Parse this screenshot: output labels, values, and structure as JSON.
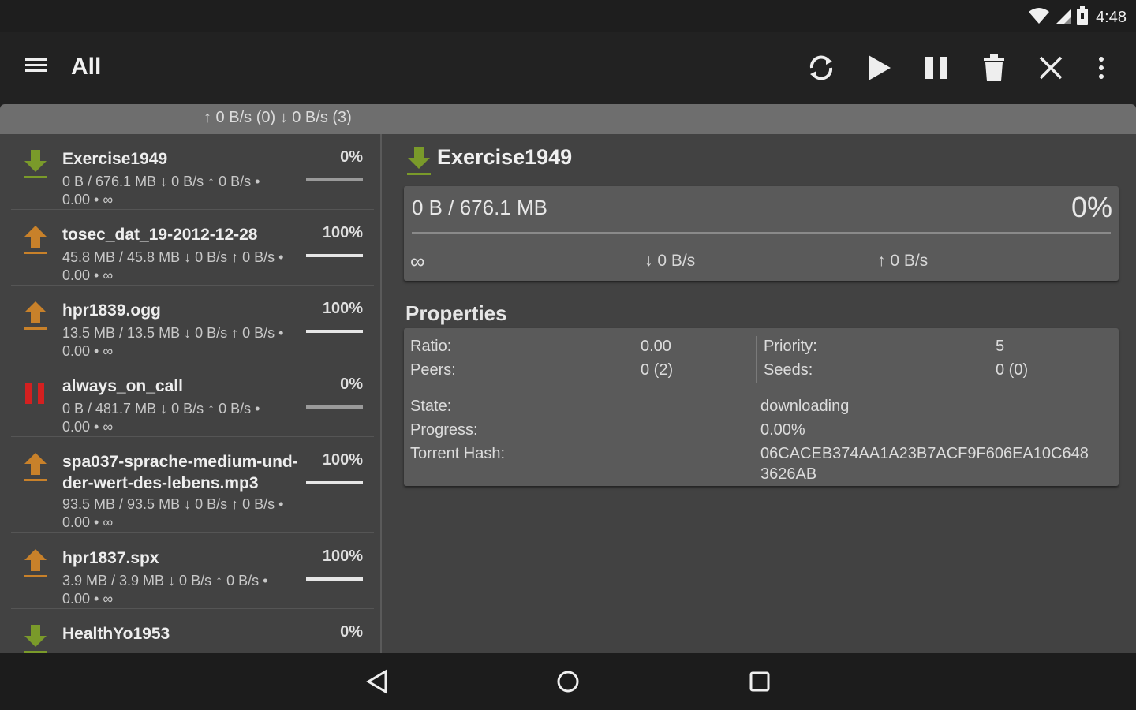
{
  "status": {
    "time": "4:48"
  },
  "appbar": {
    "title": "All",
    "icons": [
      "menu-icon",
      "refresh-icon",
      "play-icon",
      "pause-icon",
      "trash-icon",
      "close-icon",
      "more-vert-icon"
    ]
  },
  "speed_summary": "↑ 0 B/s (0) ↓ 0 B/s (3)",
  "torrents": [
    {
      "name": "Exercise1949",
      "percent": "0%",
      "progress": 0,
      "line1": "0 B / 676.1 MB ↓ 0 B/s ↑ 0 B/s •",
      "line2": "0.00 • ∞",
      "state": "download"
    },
    {
      "name": "tosec_dat_19-2012-12-28",
      "percent": "100%",
      "progress": 1,
      "line1": "45.8 MB / 45.8 MB ↓ 0 B/s ↑ 0 B/s •",
      "line2": "0.00 • ∞",
      "state": "upload"
    },
    {
      "name": "hpr1839.ogg",
      "percent": "100%",
      "progress": 1,
      "line1": "13.5 MB / 13.5 MB ↓ 0 B/s ↑ 0 B/s •",
      "line2": "0.00 • ∞",
      "state": "upload"
    },
    {
      "name": "always_on_call",
      "percent": "0%",
      "progress": 0,
      "line1": "0 B / 481.7 MB ↓ 0 B/s ↑ 0 B/s •",
      "line2": "0.00 • ∞",
      "state": "paused"
    },
    {
      "name": "spa037-sprache-medium-und-der-wert-des-lebens.mp3",
      "percent": "100%",
      "progress": 1,
      "line1": "93.5 MB / 93.5 MB ↓ 0 B/s ↑ 0 B/s •",
      "line2": "0.00 • ∞",
      "state": "upload"
    },
    {
      "name": "hpr1837.spx",
      "percent": "100%",
      "progress": 1,
      "line1": "3.9 MB / 3.9 MB ↓ 0 B/s ↑ 0 B/s •",
      "line2": "0.00 • ∞",
      "state": "upload"
    },
    {
      "name": "HealthYo1953",
      "percent": "0%",
      "progress": 0,
      "line1": "",
      "line2": "",
      "state": "download"
    }
  ],
  "detail": {
    "name": "Exercise1949",
    "size": "0 B / 676.1 MB",
    "percent": "0%",
    "eta": "∞",
    "down": "↓ 0 B/s",
    "up": "↑ 0 B/s",
    "properties_title": "Properties",
    "ratio_label": "Ratio:",
    "ratio": "0.00",
    "peers_label": "Peers:",
    "peers": "0 (2)",
    "priority_label": "Priority:",
    "priority": "5",
    "seeds_label": "Seeds:",
    "seeds": "0 (0)",
    "state_label": "State:",
    "state": "downloading",
    "progress_label": "Progress:",
    "progress": "0.00%",
    "hash_label": "Torrent Hash:",
    "hash_line1": "06CACEB374AA1A23B7ACF9F606EA10C648",
    "hash_line2": "3626AB"
  },
  "colors": {
    "download": "#7a9a2a",
    "upload": "#c8812a",
    "paused": "#d42020"
  }
}
